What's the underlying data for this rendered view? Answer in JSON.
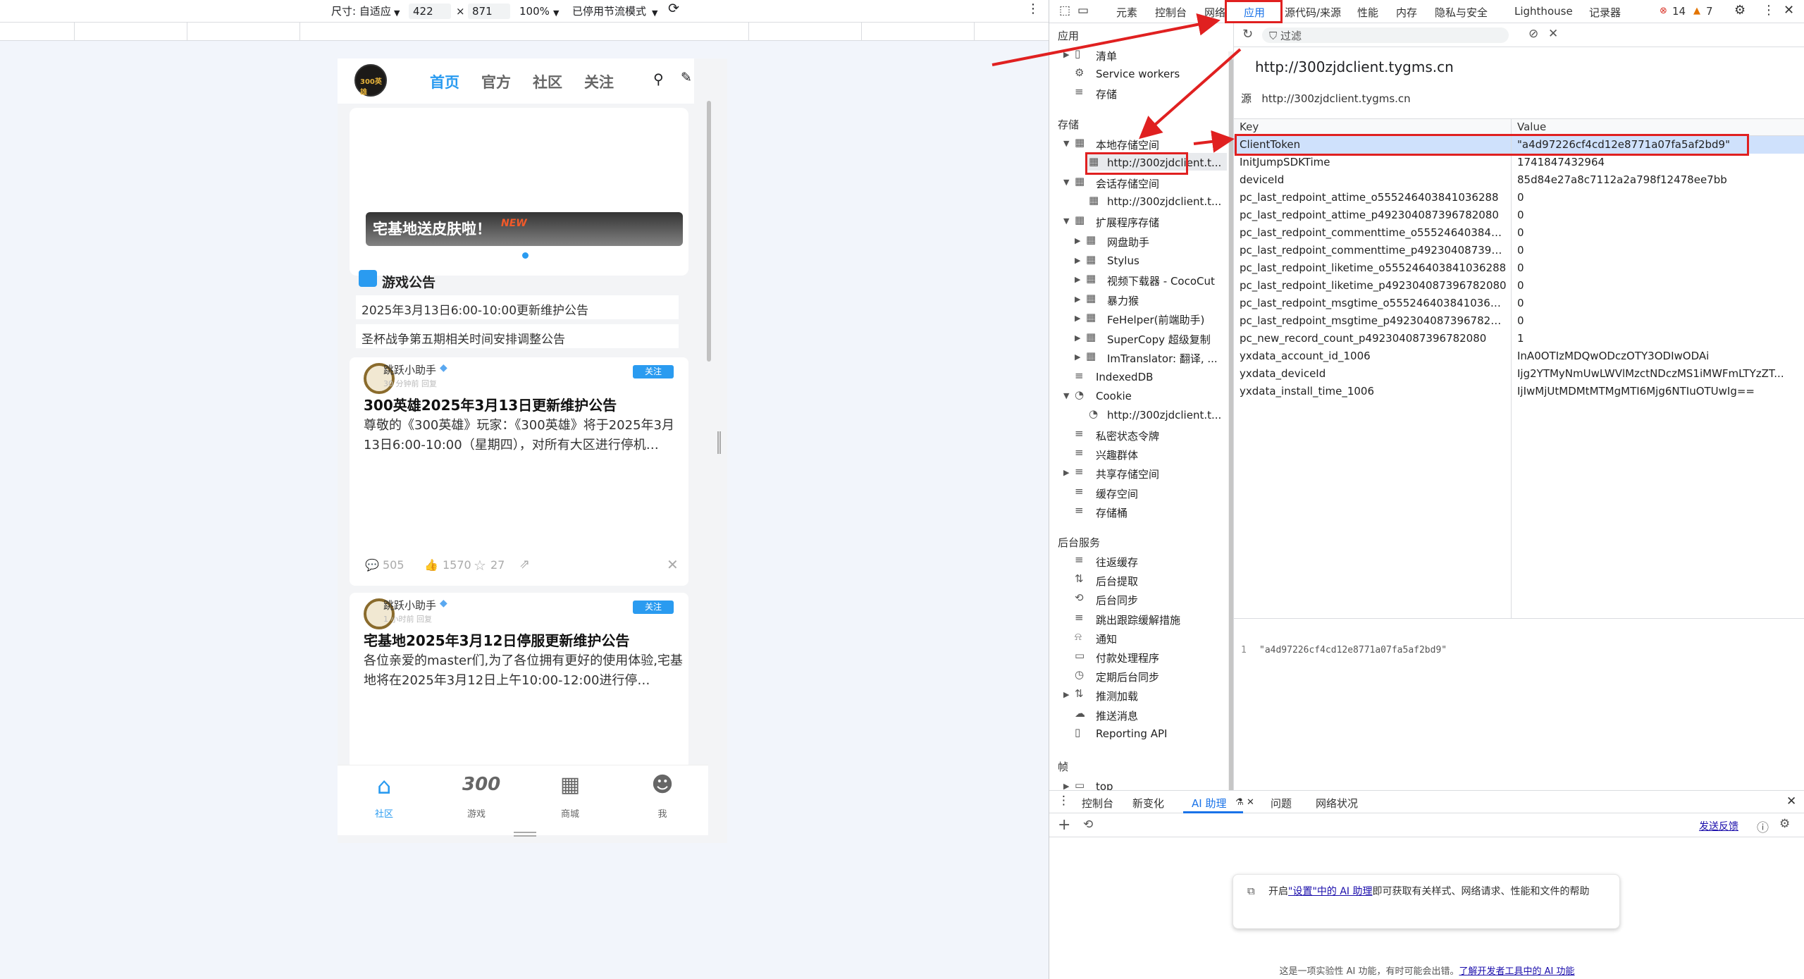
{
  "emulation_toolbar": {
    "size_label": "尺寸: 自适应",
    "width_value": "422",
    "times": "×",
    "height_value": "871",
    "zoom": "100%",
    "throttle": "已停用节流模式"
  },
  "phone": {
    "logo_text": "300英雄",
    "nav_tabs": [
      "首页",
      "官方",
      "社区",
      "关注"
    ],
    "banner_text": "宅基地送皮肤啦！",
    "banner_badge": "NEW",
    "announcement_title": "游戏公告",
    "announcements": [
      "2025年3月13日6:00-10:00更新维护公告",
      "圣杯战争第五期相关时间安排调整公告"
    ],
    "posts": [
      {
        "author": "跳跃小助手",
        "meta": "30 分钟前  回复",
        "follow": "关注",
        "title": "300英雄2025年3月13日更新维护公告",
        "body": "尊敬的《300英雄》玩家：《300英雄》将于2025年3月13日6:00-10:00（星期四），对所有大区进行停机…",
        "comments": "505",
        "likes": "1570",
        "stars": "27"
      },
      {
        "author": "跳跃小助手",
        "meta": "1 小时前  回复",
        "follow": "关注",
        "title": "宅基地2025年3月12日停服更新维护公告",
        "body": "各位亲爱的master们,为了各位拥有更好的使用体验,宅基地将在2025年3月12日上午10:00-12:00进行停…"
      }
    ],
    "bottom_nav": [
      "社区",
      "游戏",
      "商城",
      "我"
    ],
    "bottom_nav_300": "300"
  },
  "devtools": {
    "tabs": [
      "元素",
      "控制台",
      "网络",
      "应用",
      "源代码/来源",
      "性能",
      "内存",
      "隐私与安全",
      "Lighthouse",
      "记录器"
    ],
    "active_tab": "应用",
    "errors": "14",
    "warnings": "7",
    "sidebar": {
      "app_header": "应用",
      "app_items": [
        "清单",
        "Service workers",
        "存储"
      ],
      "storage_header": "存储",
      "local_storage": "本地存储空间",
      "local_storage_child": "http://300zjdclient.t...",
      "session_storage": "会话存储空间",
      "session_storage_child": "http://300zjdclient.t...",
      "extension_storage": "扩展程序存储",
      "extensions": [
        "网盘助手",
        "Stylus",
        "视频下载器 - CocoCut",
        "暴力猴",
        "FeHelper(前端助手)",
        "SuperCopy 超级复制",
        "ImTranslator: 翻译, ..."
      ],
      "indexeddb": "IndexedDB",
      "cookie": "Cookie",
      "cookie_child": "http://300zjdclient.t...",
      "more_storage": [
        "私密状态令牌",
        "兴趣群体",
        "共享存储空间",
        "缓存空间",
        "存储桶"
      ],
      "bg_header": "后台服务",
      "bg_items": [
        "往返缓存",
        "后台提取",
        "后台同步",
        "跳出跟踪缓解措施",
        "通知",
        "付款处理程序",
        "定期后台同步",
        "推测加载",
        "推送消息",
        "Reporting API"
      ],
      "frames_header": "帧",
      "frames_top": "top"
    },
    "filter_placeholder": "过滤",
    "origin_title": "http://300zjdclient.tygms.cn",
    "origin_src_label": "源",
    "origin_src": "http://300zjdclient.tygms.cn",
    "grid_headers": [
      "Key",
      "Value"
    ],
    "rows": [
      {
        "k": "ClientToken",
        "v": "\"a4d97226cf4cd12e8771a07fa5af2bd9\""
      },
      {
        "k": "InitJumpSDKTime",
        "v": "1741847432964"
      },
      {
        "k": "deviceId",
        "v": "85d84e27a8c7112a2a798f12478ee7bb"
      },
      {
        "k": "pc_last_redpoint_attime_o555246403841036288",
        "v": "0"
      },
      {
        "k": "pc_last_redpoint_attime_p492304087396782080",
        "v": "0"
      },
      {
        "k": "pc_last_redpoint_commenttime_o55524640384103...",
        "v": "0"
      },
      {
        "k": "pc_last_redpoint_commenttime_p49230408739678...",
        "v": "0"
      },
      {
        "k": "pc_last_redpoint_liketime_o555246403841036288",
        "v": "0"
      },
      {
        "k": "pc_last_redpoint_liketime_p492304087396782080",
        "v": "0"
      },
      {
        "k": "pc_last_redpoint_msgtime_o555246403841036288",
        "v": "0"
      },
      {
        "k": "pc_last_redpoint_msgtime_p492304087396782080",
        "v": "0"
      },
      {
        "k": "pc_new_record_count_p492304087396782080",
        "v": "1"
      },
      {
        "k": "yxdata_account_id_1006",
        "v": "InA0OTIzMDQwODczOTY3ODIwODAi"
      },
      {
        "k": "yxdata_deviceId",
        "v": "Ijg2YTMyNmUwLWVlMzctNDczMS1iMWFmLTYzZT..."
      },
      {
        "k": "yxdata_install_time_1006",
        "v": "IjIwMjUtMDMtMTMgMTI6Mjg6NTIuOTUwIg=="
      }
    ],
    "preview_line_num": "1",
    "preview_value": "\"a4d97226cf4cd12e8771a07fa5af2bd9\"",
    "drawer": {
      "tabs": [
        "控制台",
        "新变化",
        "AI 助理",
        "问题",
        "网络状况"
      ],
      "active_tab": "AI 助理",
      "feedback": "发送反馈",
      "card_text_1": "开启",
      "card_link": "\"设置\"中的 AI 助理",
      "card_text_2": "即可获取有关样式、网络请求、性能和文件的帮助",
      "footer_text": "这是一项实验性 AI 功能，有时可能会出错。",
      "footer_link": "了解开发者工具中的 AI 功能"
    }
  },
  "colors": {
    "accent_blue": "#2a9bf0",
    "devtools_blue": "#1a73e8",
    "annotation_red": "#e02020",
    "selected_row": "#cfe1fc"
  }
}
